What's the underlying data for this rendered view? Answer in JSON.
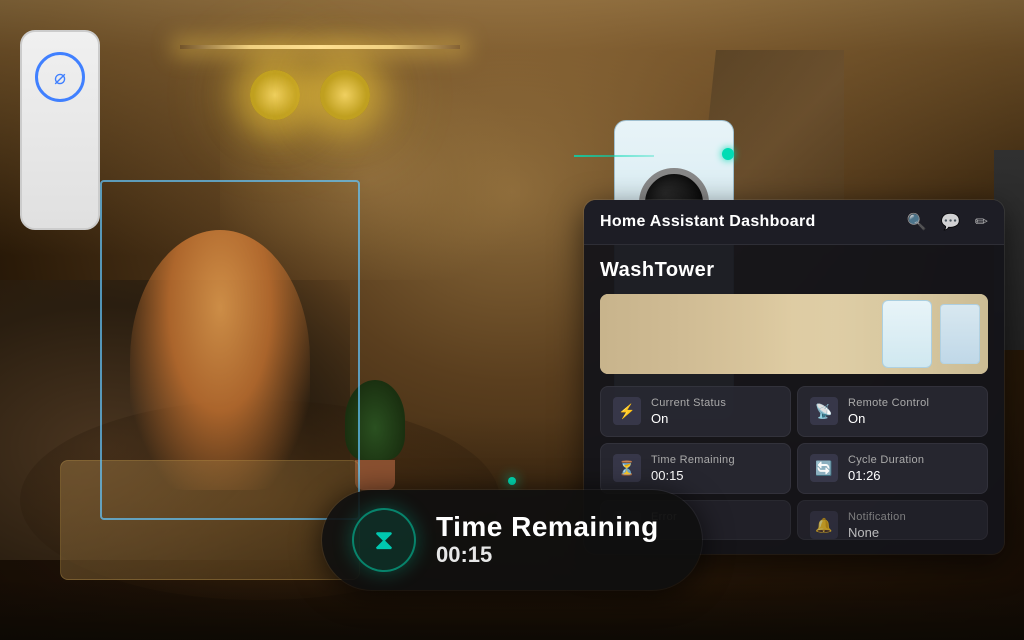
{
  "background": {
    "description": "Smart home living room scene"
  },
  "dashboard": {
    "title": "Home Assistant Dashboard",
    "device_name": "WashTower",
    "icons": {
      "search": "🔍",
      "chat": "💬",
      "edit": "✏"
    },
    "status_cards": [
      {
        "id": "current-status",
        "label": "Current Status",
        "value": "On",
        "icon": "⚡"
      },
      {
        "id": "remote-control",
        "label": "Remote Control",
        "value": "On",
        "icon": "📡"
      },
      {
        "id": "time-remaining",
        "label": "Time Remaining",
        "value": "00:15",
        "icon": "⏳"
      },
      {
        "id": "cycle-duration",
        "label": "Cycle Duration",
        "value": "01:26",
        "icon": "🔄"
      },
      {
        "id": "error",
        "label": "Error",
        "value": "",
        "icon": "⚠"
      },
      {
        "id": "notification",
        "label": "Notification",
        "value": "None",
        "icon": "🔔"
      }
    ]
  },
  "time_pill": {
    "label": "Time Remaining",
    "value": "00:15",
    "icon": "⧗"
  }
}
